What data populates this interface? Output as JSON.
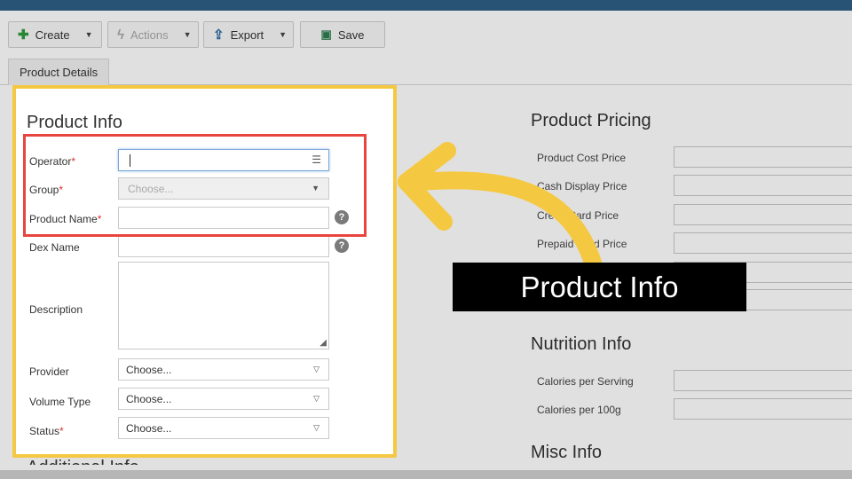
{
  "toolbar": {
    "create_label": "Create",
    "actions_label": "Actions",
    "export_label": "Export",
    "save_label": "Save"
  },
  "tabs": [
    {
      "label": "Product Details"
    }
  ],
  "product_info": {
    "title": "Product Info",
    "fields": {
      "operator": {
        "label": "Operator",
        "required": "*",
        "value": ""
      },
      "group": {
        "label": "Group",
        "required": "*",
        "placeholder": "Choose..."
      },
      "product_name": {
        "label": "Product Name",
        "required": "*",
        "value": ""
      },
      "dex_name": {
        "label": "Dex Name",
        "value": ""
      },
      "description": {
        "label": "Description",
        "value": ""
      },
      "provider": {
        "label": "Provider",
        "value": "Choose..."
      },
      "volume_type": {
        "label": "Volume Type",
        "value": "Choose..."
      },
      "status": {
        "label": "Status",
        "required": "*",
        "value": "Choose..."
      }
    },
    "next_section_title": "Additional Info"
  },
  "product_pricing": {
    "title": "Product Pricing",
    "fields": [
      {
        "label": "Product Cost Price"
      },
      {
        "label": "Cash Display Price"
      },
      {
        "label": "Credit Card Price"
      },
      {
        "label": "Prepaid Card Price"
      }
    ]
  },
  "nutrition_info": {
    "title": "Nutrition Info",
    "fields": [
      {
        "label": "Calories per Serving"
      },
      {
        "label": "Calories per 100g"
      }
    ]
  },
  "misc_info": {
    "title": "Misc Info"
  },
  "callout": {
    "text": "Product Info"
  },
  "icons": {
    "help": "?",
    "list": "☰",
    "caret": "▼",
    "select_caret": "▽"
  },
  "colors": {
    "highlight_border": "#f5c842",
    "focus_box": "#e8453f",
    "arrow": "#f5c842",
    "callout_bg": "#000000"
  }
}
